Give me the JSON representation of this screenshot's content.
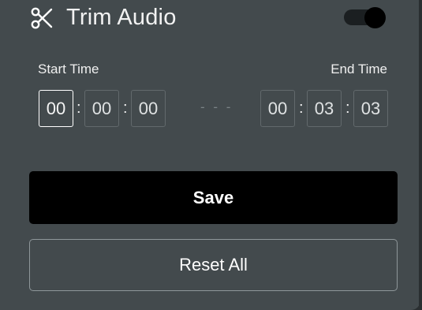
{
  "header": {
    "icon": "scissors-icon",
    "title": "Trim Audio",
    "toggle_on": true
  },
  "start_time": {
    "label": "Start Time",
    "hours": "00",
    "minutes": "00",
    "seconds": "00"
  },
  "end_time": {
    "label": "End Time",
    "hours": "00",
    "minutes": "03",
    "seconds": "03"
  },
  "separator": "- - -",
  "colon": ":",
  "buttons": {
    "save": "Save",
    "reset": "Reset All"
  },
  "colors": {
    "panel_bg": "#434a4d",
    "save_bg": "#000000",
    "text": "#ffffff"
  }
}
